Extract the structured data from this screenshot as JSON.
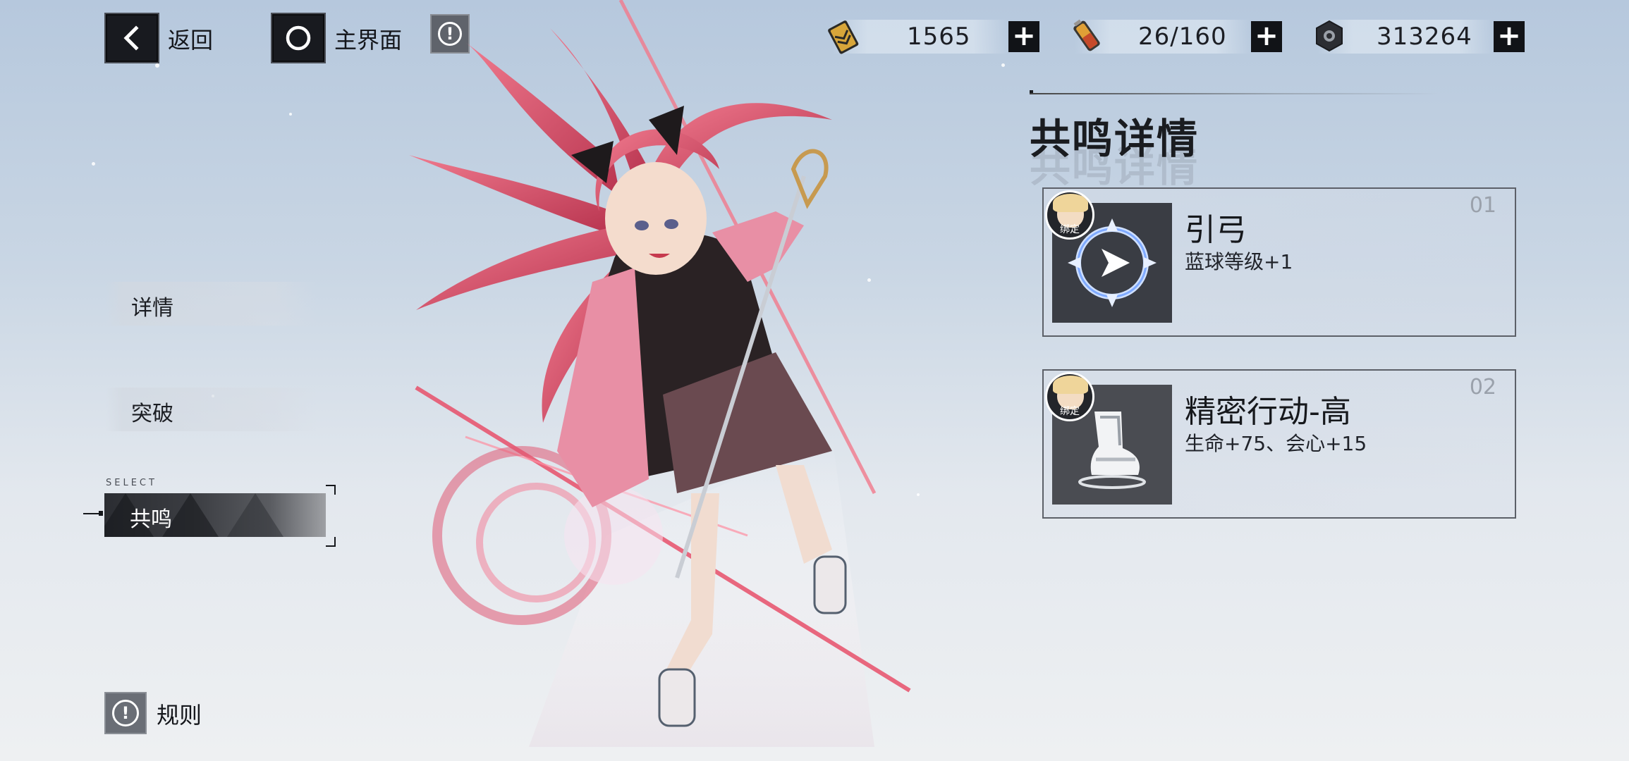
{
  "topbar": {
    "back_label": "返回",
    "home_label": "主界面",
    "back_icon": "chevron-left-icon",
    "home_icon": "circle-icon",
    "info_icon": "exclamation-info-icon"
  },
  "resources": [
    {
      "icon": "gold-ticket-icon",
      "value": "1565"
    },
    {
      "icon": "energy-battery-icon",
      "value": "26/160"
    },
    {
      "icon": "hex-nut-coin-icon",
      "value": "313264"
    }
  ],
  "sidebar": {
    "items": [
      {
        "label": "详情",
        "active": false
      },
      {
        "label": "突破",
        "active": false
      },
      {
        "label": "共鸣",
        "active": true
      }
    ],
    "select_tag": "SELECT"
  },
  "rules": {
    "label": "规则"
  },
  "panel": {
    "title": "共鸣详情",
    "cards": [
      {
        "number": "01",
        "title": "引弓",
        "desc": "蓝球等级+1",
        "badge": "绑定",
        "icon": "compass-arrow-icon"
      },
      {
        "number": "02",
        "title": "精密行动-高",
        "desc": "生命+75、会心+15",
        "badge": "绑定",
        "icon": "boot-icon"
      }
    ]
  },
  "colors": {
    "accent_dark": "#181a1f",
    "hair_pink": "#e0607a",
    "compass_blue": "#9ec3ff"
  }
}
